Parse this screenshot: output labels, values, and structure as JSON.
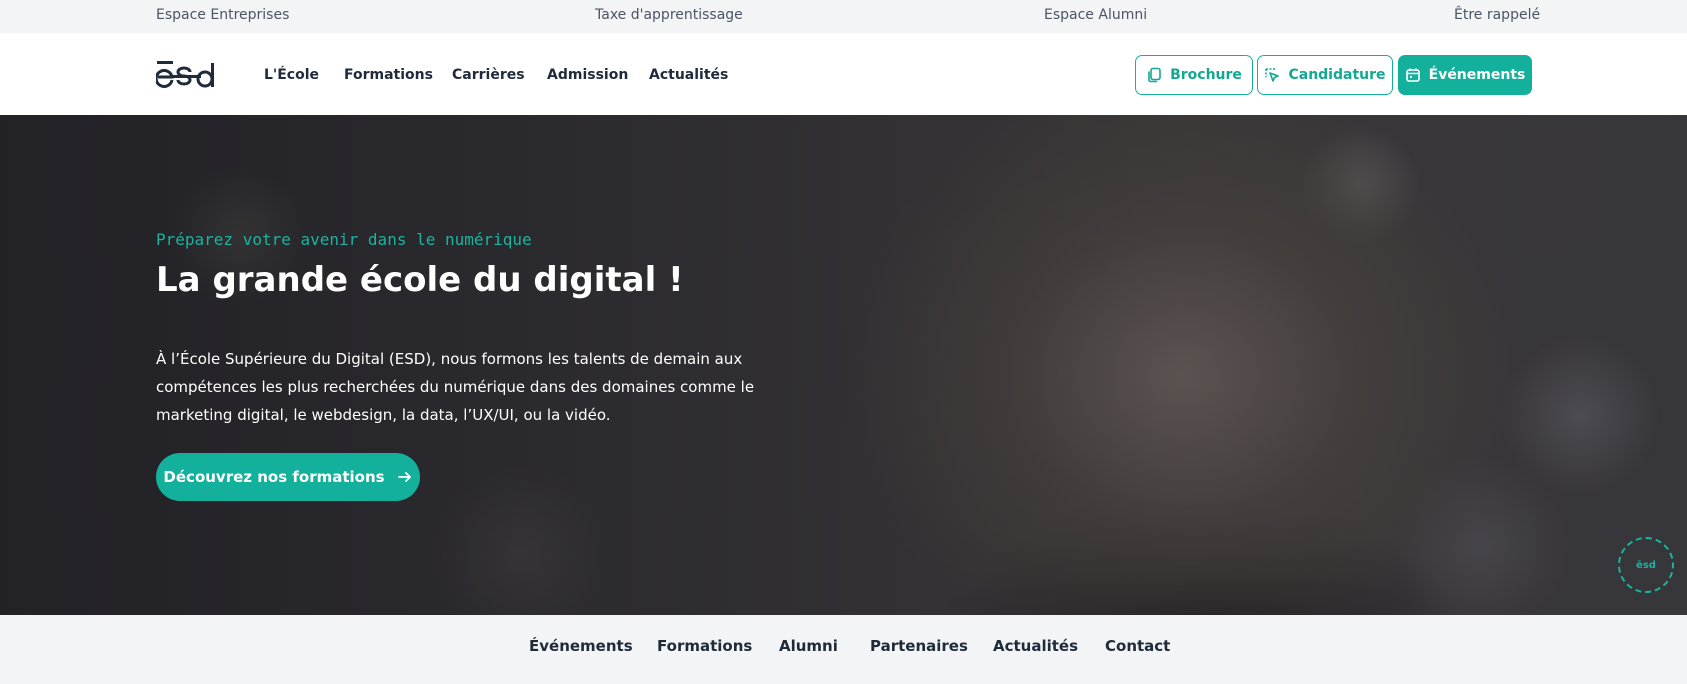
{
  "topbar": {
    "links": [
      "Espace Entreprises",
      "Taxe d'apprentissage",
      "Espace Alumni",
      "Être rappelé"
    ]
  },
  "header": {
    "logo_text": "ēsd",
    "nav": [
      "L'École",
      "Formations",
      "Carrières",
      "Admission",
      "Actualités"
    ],
    "buttons": {
      "brochure": "Brochure",
      "candidature": "Candidature",
      "evenements": "Événements"
    },
    "icons": {
      "brochure": "document-copy-icon",
      "candidature": "cursor-click-icon",
      "evenements": "calendar-icon"
    }
  },
  "hero": {
    "kicker": "Préparez votre avenir dans le numérique",
    "title": "La grande école du digital !",
    "text": "À l’École Supérieure du Digital (ESD), nous formons les talents de demain aux compétences les plus recherchées du numérique dans des domaines comme le marketing digital, le webdesign, la data, l’UX/UI, ou la vidéo.",
    "cta_label": "Découvrez nos formations",
    "cta_icon": "arrow-right-icon",
    "badge_text": "ēsd"
  },
  "subnav": {
    "items": [
      "Événements",
      "Formations",
      "Alumni",
      "Partenaires",
      "Actualités",
      "Contact"
    ]
  },
  "colors": {
    "accent": "#13b19b",
    "dark_text": "#1f2a3a",
    "bar_bg": "#f2f4f5"
  }
}
